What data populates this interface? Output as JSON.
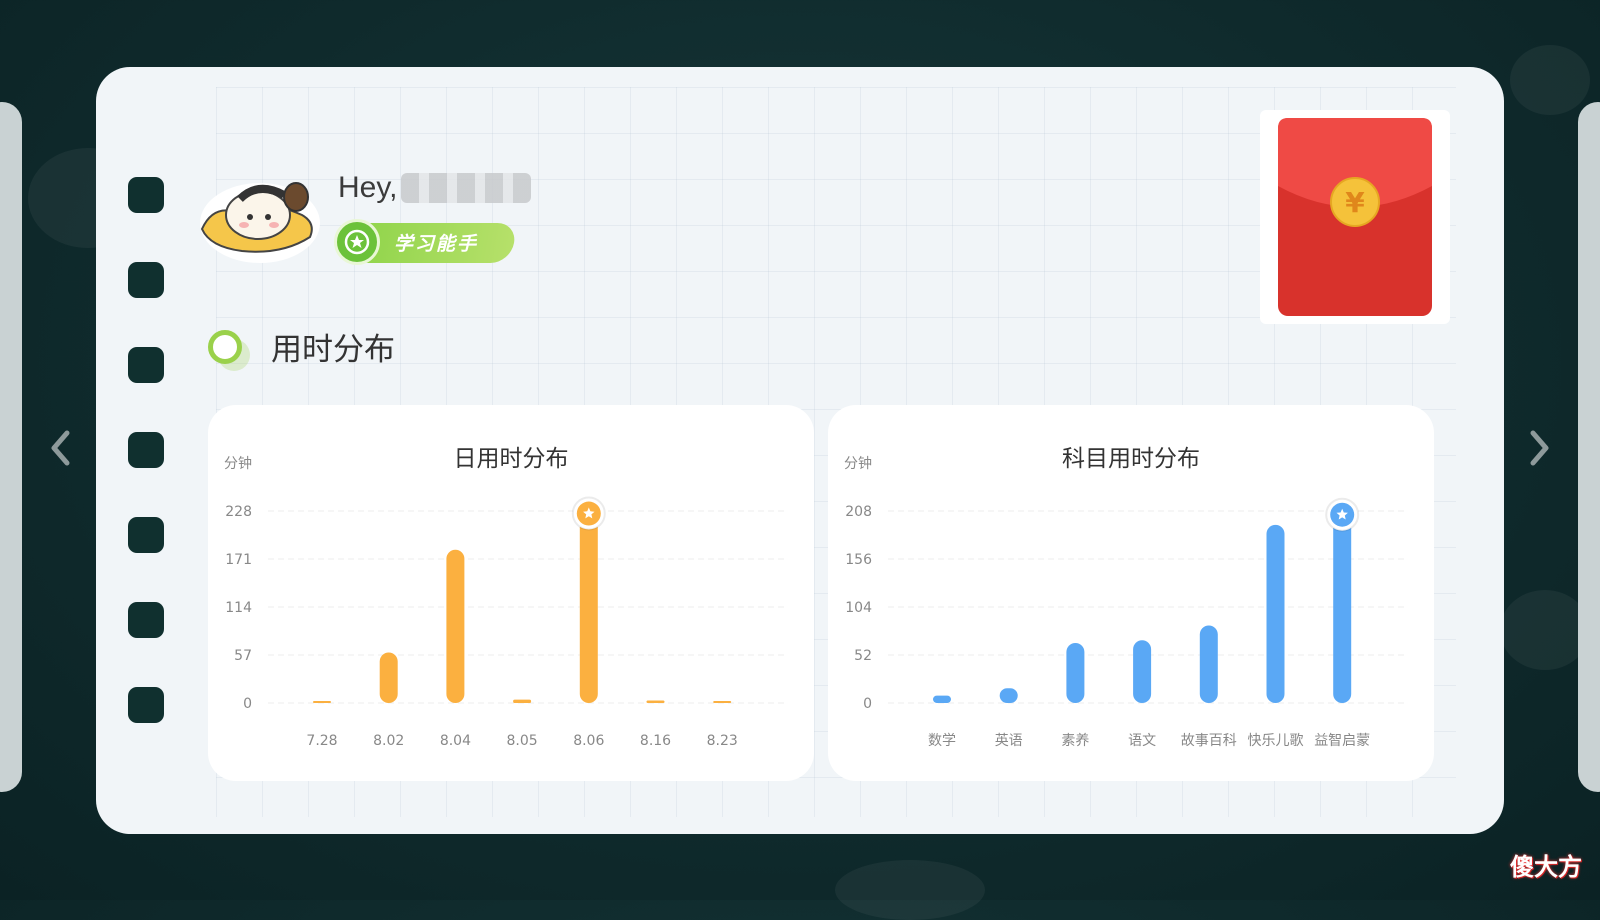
{
  "user": {
    "greeting": "Hey,",
    "badge": "学习能手"
  },
  "section": {
    "title": "用时分布"
  },
  "icons": [
    "chevron-left-icon",
    "chevron-right-icon",
    "medal-icon",
    "star-icon",
    "yuan-coin-icon",
    "red-packet-icon",
    "avatar-icon"
  ],
  "colors": {
    "card_bg": "#f1f5f8",
    "orange_bar": "#fbb040",
    "blue_bar": "#5aa8f5",
    "badge_green": "#8fd44a",
    "red_packet": "#e23b35"
  },
  "watermark": "傻大方",
  "chart_data": [
    {
      "type": "bar",
      "title": "日用时分布",
      "ylabel": "分钟",
      "categories": [
        "7.28",
        "8.02",
        "8.04",
        "8.05",
        "8.06",
        "8.16",
        "8.23"
      ],
      "values": [
        1,
        60,
        182,
        4,
        225,
        3,
        2
      ],
      "yticks": [
        "0",
        "57",
        "114",
        "171",
        "228"
      ],
      "ylim": [
        0,
        228
      ],
      "highlight_index": 4,
      "color": "#fbb040"
    },
    {
      "type": "bar",
      "title": "科目用时分布",
      "ylabel": "分钟",
      "categories": [
        "数学",
        "英语",
        "素养",
        "语文",
        "故事百科",
        "快乐儿歌",
        "益智启蒙"
      ],
      "values": [
        8,
        16,
        65,
        68,
        84,
        193,
        204
      ],
      "yticks": [
        "0",
        "52",
        "104",
        "156",
        "208"
      ],
      "ylim": [
        0,
        208
      ],
      "highlight_index": 6,
      "color": "#5aa8f5"
    }
  ]
}
